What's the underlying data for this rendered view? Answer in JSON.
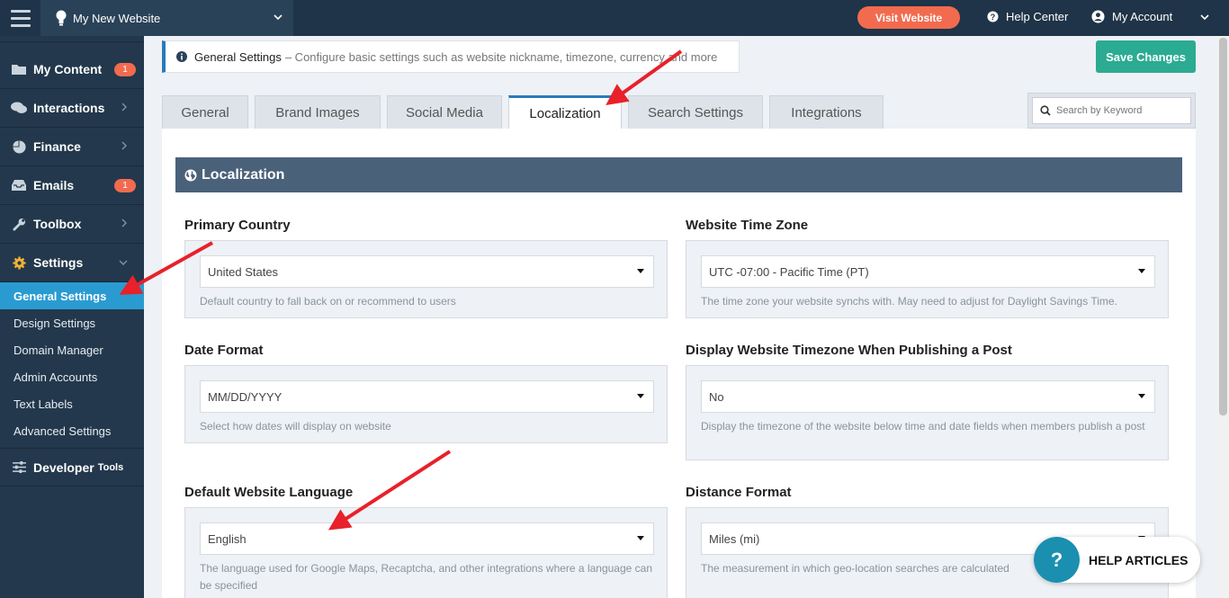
{
  "topbar": {
    "website_name": "My New Website",
    "visit_label": "Visit Website",
    "help_center_label": "Help Center",
    "my_account_label": "My Account"
  },
  "sidebar": {
    "items": [
      {
        "label": "My Content",
        "badge": "1"
      },
      {
        "label": "Interactions"
      },
      {
        "label": "Finance"
      },
      {
        "label": "Emails",
        "badge": "1"
      },
      {
        "label": "Toolbox"
      },
      {
        "label": "Settings"
      }
    ],
    "settings_sub": [
      "General Settings",
      "Design Settings",
      "Domain Manager",
      "Admin Accounts",
      "Text Labels",
      "Advanced Settings"
    ],
    "developer_label": "Developer",
    "developer_suffix": "Tools"
  },
  "info": {
    "title": "General Settings",
    "description": "– Configure basic settings such as website nickname, timezone, currency and more"
  },
  "save_label": "Save Changes",
  "tabs": [
    "General",
    "Brand Images",
    "Social Media",
    "Localization",
    "Search Settings",
    "Integrations"
  ],
  "active_tab": "Localization",
  "search": {
    "placeholder": "Search by Keyword"
  },
  "section_title": "Localization",
  "fields": {
    "primary_country": {
      "label": "Primary Country",
      "value": "United States",
      "help": "Default country to fall back on or recommend to users"
    },
    "time_zone": {
      "label": "Website Time Zone",
      "value": "UTC -07:00 - Pacific Time (PT)",
      "help": "The time zone your website synchs with. May need to adjust for Daylight Savings Time."
    },
    "date_format": {
      "label": "Date Format",
      "value": "MM/DD/YYYY",
      "help": "Select how dates will display on website"
    },
    "display_timezone": {
      "label": "Display Website Timezone When Publishing a Post",
      "value": "No",
      "help": "Display the timezone of the website below time and date fields when members publish a post"
    },
    "language": {
      "label": "Default Website Language",
      "value": "English",
      "help": "The language used for Google Maps, Recaptcha, and other integrations where a language can be specified"
    },
    "distance": {
      "label": "Distance Format",
      "value": "Miles (mi)",
      "help": "The measurement in which geo-location searches are calculated"
    }
  },
  "help_articles_label": "HELP ARTICLES",
  "colors": {
    "topbar": "#1f3448",
    "sidebar": "#23384c",
    "accent_orange": "#f26b4f",
    "accent_teal": "#2bab92",
    "active_blue": "#2a9bd1",
    "section_header": "#4a617a",
    "annotation_red": "#e8212a"
  }
}
